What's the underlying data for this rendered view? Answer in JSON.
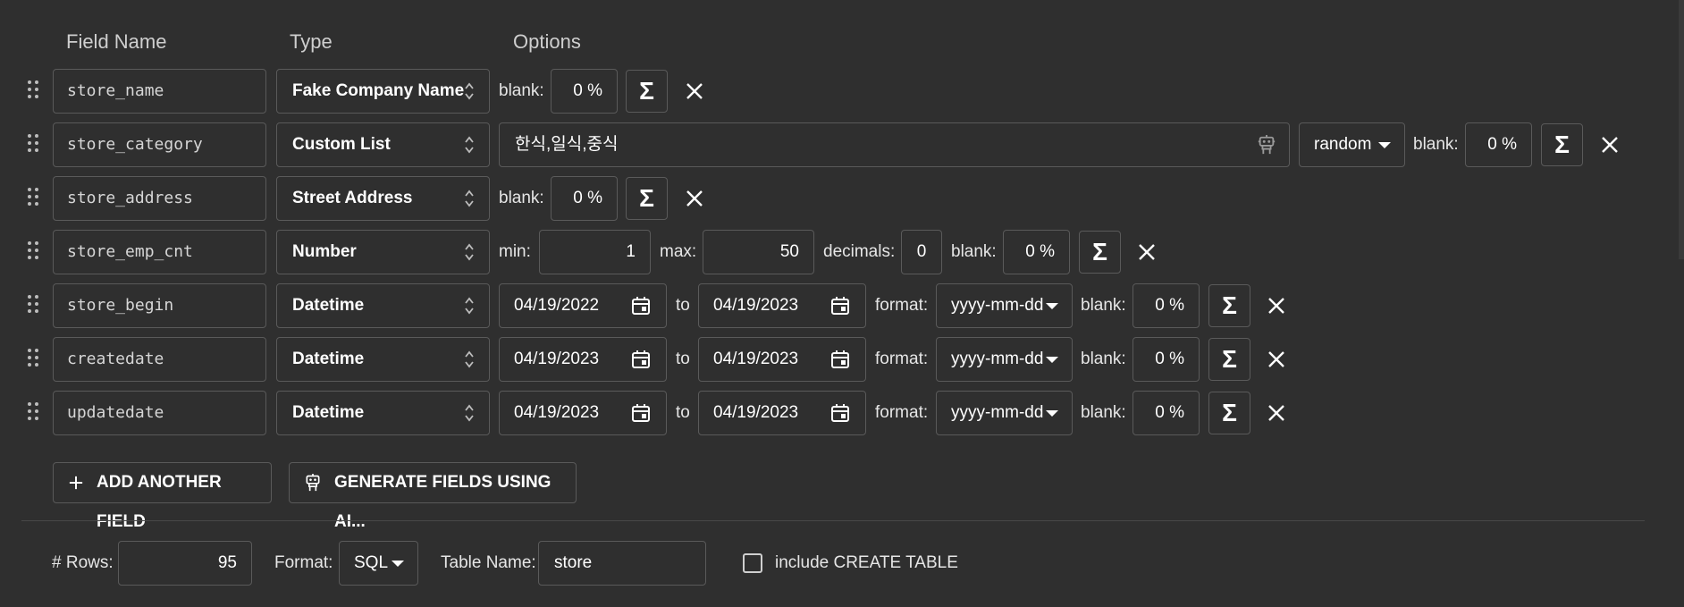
{
  "headers": {
    "field_name": "Field Name",
    "type": "Type",
    "options": "Options"
  },
  "fields": [
    {
      "name": "store_name",
      "type": "Fake Company Name",
      "blank": "0 %"
    },
    {
      "name": "store_category",
      "type": "Custom List",
      "list_value": "한식,일식,중식",
      "order": "random",
      "blank": "0 %"
    },
    {
      "name": "store_address",
      "type": "Street Address",
      "blank": "0 %"
    },
    {
      "name": "store_emp_cnt",
      "type": "Number",
      "min": "1",
      "max": "50",
      "decimals": "0",
      "blank": "0 %"
    },
    {
      "name": "store_begin",
      "type": "Datetime",
      "from": "04/19/2022",
      "to": "04/19/2023",
      "format": "yyyy-mm-dd",
      "blank": "0 %"
    },
    {
      "name": "createdate",
      "type": "Datetime",
      "from": "04/19/2023",
      "to": "04/19/2023",
      "format": "yyyy-mm-dd",
      "blank": "0 %"
    },
    {
      "name": "updatedate",
      "type": "Datetime",
      "from": "04/19/2023",
      "to": "04/19/2023",
      "format": "yyyy-mm-dd",
      "blank": "0 %"
    }
  ],
  "labels": {
    "blank": "blank:",
    "min": "min:",
    "max": "max:",
    "decimals": "decimals:",
    "to": "to",
    "format": "format:",
    "sigma": "Σ"
  },
  "buttons": {
    "add_field": "ADD ANOTHER FIELD",
    "generate_ai": "GENERATE FIELDS USING AI..."
  },
  "footer": {
    "rows_label": "# Rows:",
    "rows_value": "95",
    "format_label": "Format:",
    "format_value": "SQL",
    "table_label": "Table Name:",
    "table_value": "store",
    "create_table_label": "include CREATE TABLE"
  },
  "icons": [
    "drag-handle-icon",
    "up-down-icon",
    "sigma-icon",
    "close-icon",
    "robot-icon",
    "calendar-icon",
    "caret-down-icon",
    "plus-icon",
    "checkbox-icon"
  ]
}
